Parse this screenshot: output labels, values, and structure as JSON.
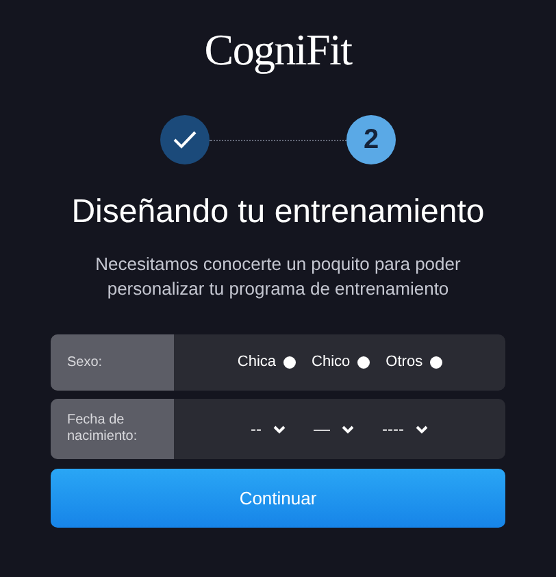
{
  "logo": {
    "text": "CogniFit"
  },
  "steps": [
    {
      "kind": "done",
      "selected": false
    },
    {
      "kind": "current",
      "label": "2",
      "selected": true
    }
  ],
  "title": "Diseñando tu entrenamiento",
  "subtitle": "Necesitamos conocerte un poquito para poder personalizar tu programa de entrenamiento",
  "form": [
    {
      "kind": "radio",
      "label": "Sexo:",
      "options": [
        {
          "label": "Chica",
          "selected": false
        },
        {
          "label": "Chico",
          "selected": false
        },
        {
          "label": "Otros",
          "selected": false
        }
      ]
    },
    {
      "kind": "date",
      "label": "Fecha de nacimiento:",
      "selects": [
        {
          "value": "--"
        },
        {
          "value": "—"
        },
        {
          "value": "----"
        }
      ]
    }
  ],
  "button": "Continuar"
}
